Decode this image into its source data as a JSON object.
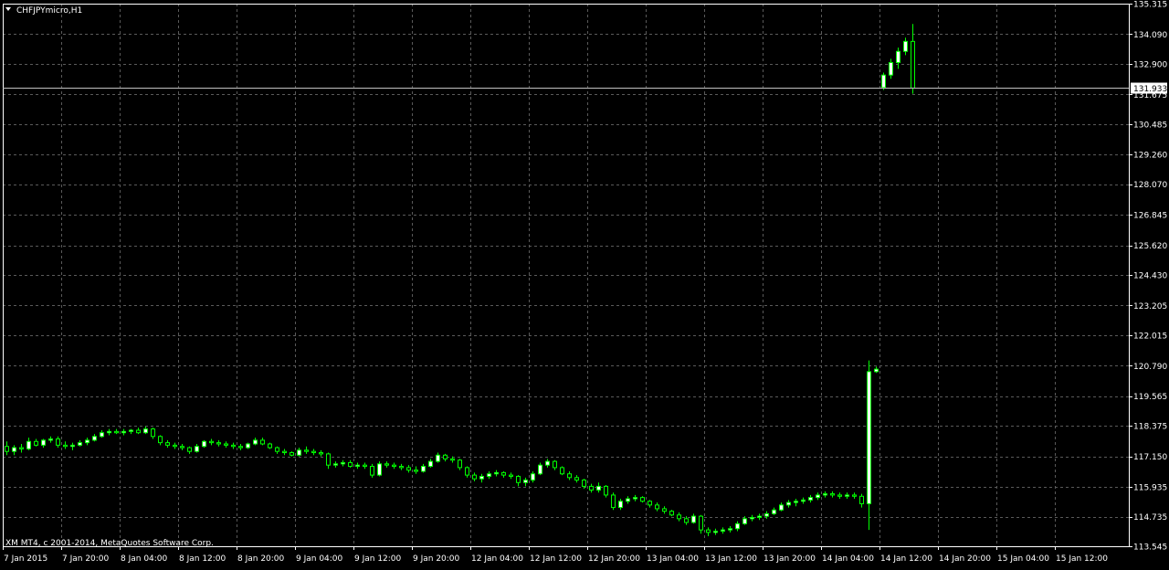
{
  "window": {
    "symbol_label": "CHFJPYmicro,H1",
    "copyright": "XM MT4, c 2001-2014, MetaQuotes Software Corp."
  },
  "colors": {
    "background": "#000000",
    "foreground": "#FFFFFF",
    "grid": "#5A5A5A",
    "bull_candle_fill": "#FFFFFF",
    "bear_candle_fill": "#000000",
    "candle_outline": "#00FF00",
    "bid_line": "#C0C0C0",
    "bid_label_bg": "#FFFFFF",
    "bid_label_text": "#000000"
  },
  "chart_data": {
    "type": "candlestick",
    "timeframe": "H1",
    "y_range": [
      113.545,
      135.315
    ],
    "y_ticks": [
      "135.315",
      "134.090",
      "132.900",
      "131.675",
      "130.485",
      "129.260",
      "128.070",
      "126.845",
      "125.620",
      "124.430",
      "123.205",
      "122.015",
      "120.790",
      "119.565",
      "118.375",
      "117.150",
      "115.935",
      "114.735",
      "113.545"
    ],
    "x_ticks": [
      "7 Jan 2015",
      "7 Jan 20:00",
      "8 Jan 04:00",
      "8 Jan 12:00",
      "8 Jan 20:00",
      "9 Jan 04:00",
      "9 Jan 12:00",
      "9 Jan 20:00",
      "12 Jan 04:00",
      "12 Jan 12:00",
      "12 Jan 20:00",
      "13 Jan 04:00",
      "13 Jan 12:00",
      "13 Jan 20:00",
      "14 Jan 04:00",
      "14 Jan 12:00",
      "14 Jan 20:00",
      "15 Jan 04:00",
      "15 Jan 12:00"
    ],
    "bid_price": "131.933",
    "bid_value": 131.933,
    "grid": true,
    "candles": [
      {
        "o": 117.55,
        "h": 117.75,
        "l": 117.2,
        "c": 117.35
      },
      {
        "o": 117.35,
        "h": 117.6,
        "l": 117.2,
        "c": 117.5
      },
      {
        "o": 117.5,
        "h": 117.65,
        "l": 117.3,
        "c": 117.45
      },
      {
        "o": 117.45,
        "h": 117.9,
        "l": 117.4,
        "c": 117.75
      },
      {
        "o": 117.75,
        "h": 117.85,
        "l": 117.55,
        "c": 117.6
      },
      {
        "o": 117.6,
        "h": 117.85,
        "l": 117.5,
        "c": 117.8
      },
      {
        "o": 117.8,
        "h": 117.95,
        "l": 117.7,
        "c": 117.85
      },
      {
        "o": 117.85,
        "h": 117.95,
        "l": 117.5,
        "c": 117.6
      },
      {
        "o": 117.6,
        "h": 117.75,
        "l": 117.45,
        "c": 117.55
      },
      {
        "o": 117.55,
        "h": 117.7,
        "l": 117.4,
        "c": 117.6
      },
      {
        "o": 117.6,
        "h": 117.8,
        "l": 117.55,
        "c": 117.7
      },
      {
        "o": 117.7,
        "h": 117.9,
        "l": 117.6,
        "c": 117.8
      },
      {
        "o": 117.8,
        "h": 118.05,
        "l": 117.75,
        "c": 117.95
      },
      {
        "o": 117.95,
        "h": 118.2,
        "l": 117.9,
        "c": 118.1
      },
      {
        "o": 118.1,
        "h": 118.25,
        "l": 118.0,
        "c": 118.15
      },
      {
        "o": 118.15,
        "h": 118.25,
        "l": 118.05,
        "c": 118.1
      },
      {
        "o": 118.1,
        "h": 118.25,
        "l": 118.0,
        "c": 118.15
      },
      {
        "o": 118.15,
        "h": 118.25,
        "l": 118.05,
        "c": 118.2
      },
      {
        "o": 118.2,
        "h": 118.3,
        "l": 118.05,
        "c": 118.1
      },
      {
        "o": 118.1,
        "h": 118.35,
        "l": 118.05,
        "c": 118.25
      },
      {
        "o": 118.25,
        "h": 118.3,
        "l": 117.85,
        "c": 117.95
      },
      {
        "o": 117.95,
        "h": 118.0,
        "l": 117.6,
        "c": 117.7
      },
      {
        "o": 117.7,
        "h": 117.8,
        "l": 117.5,
        "c": 117.6
      },
      {
        "o": 117.6,
        "h": 117.7,
        "l": 117.45,
        "c": 117.55
      },
      {
        "o": 117.55,
        "h": 117.65,
        "l": 117.4,
        "c": 117.5
      },
      {
        "o": 117.5,
        "h": 117.55,
        "l": 117.25,
        "c": 117.35
      },
      {
        "o": 117.35,
        "h": 117.65,
        "l": 117.3,
        "c": 117.55
      },
      {
        "o": 117.55,
        "h": 117.8,
        "l": 117.5,
        "c": 117.75
      },
      {
        "o": 117.75,
        "h": 117.85,
        "l": 117.6,
        "c": 117.7
      },
      {
        "o": 117.7,
        "h": 117.8,
        "l": 117.55,
        "c": 117.65
      },
      {
        "o": 117.65,
        "h": 117.75,
        "l": 117.5,
        "c": 117.6
      },
      {
        "o": 117.6,
        "h": 117.7,
        "l": 117.45,
        "c": 117.55
      },
      {
        "o": 117.55,
        "h": 117.65,
        "l": 117.4,
        "c": 117.5
      },
      {
        "o": 117.5,
        "h": 117.7,
        "l": 117.45,
        "c": 117.65
      },
      {
        "o": 117.65,
        "h": 117.9,
        "l": 117.6,
        "c": 117.8
      },
      {
        "o": 117.8,
        "h": 117.9,
        "l": 117.6,
        "c": 117.65
      },
      {
        "o": 117.65,
        "h": 117.7,
        "l": 117.45,
        "c": 117.5
      },
      {
        "o": 117.5,
        "h": 117.55,
        "l": 117.25,
        "c": 117.35
      },
      {
        "o": 117.35,
        "h": 117.45,
        "l": 117.2,
        "c": 117.3
      },
      {
        "o": 117.3,
        "h": 117.35,
        "l": 117.15,
        "c": 117.2
      },
      {
        "o": 117.2,
        "h": 117.5,
        "l": 117.15,
        "c": 117.4
      },
      {
        "o": 117.4,
        "h": 117.55,
        "l": 117.25,
        "c": 117.35
      },
      {
        "o": 117.35,
        "h": 117.45,
        "l": 117.2,
        "c": 117.3
      },
      {
        "o": 117.3,
        "h": 117.4,
        "l": 117.15,
        "c": 117.25
      },
      {
        "o": 117.25,
        "h": 117.3,
        "l": 116.65,
        "c": 116.8
      },
      {
        "o": 116.8,
        "h": 116.95,
        "l": 116.7,
        "c": 116.85
      },
      {
        "o": 116.85,
        "h": 117.0,
        "l": 116.75,
        "c": 116.9
      },
      {
        "o": 116.9,
        "h": 117.0,
        "l": 116.7,
        "c": 116.75
      },
      {
        "o": 116.75,
        "h": 116.9,
        "l": 116.65,
        "c": 116.8
      },
      {
        "o": 116.8,
        "h": 116.9,
        "l": 116.65,
        "c": 116.75
      },
      {
        "o": 116.75,
        "h": 116.85,
        "l": 116.3,
        "c": 116.4
      },
      {
        "o": 116.4,
        "h": 116.95,
        "l": 116.35,
        "c": 116.85
      },
      {
        "o": 116.85,
        "h": 116.95,
        "l": 116.7,
        "c": 116.8
      },
      {
        "o": 116.8,
        "h": 116.9,
        "l": 116.65,
        "c": 116.75
      },
      {
        "o": 116.75,
        "h": 116.85,
        "l": 116.6,
        "c": 116.7
      },
      {
        "o": 116.7,
        "h": 116.8,
        "l": 116.5,
        "c": 116.6
      },
      {
        "o": 116.6,
        "h": 116.75,
        "l": 116.45,
        "c": 116.55
      },
      {
        "o": 116.55,
        "h": 116.85,
        "l": 116.5,
        "c": 116.75
      },
      {
        "o": 116.75,
        "h": 117.05,
        "l": 116.7,
        "c": 116.95
      },
      {
        "o": 116.95,
        "h": 117.3,
        "l": 116.9,
        "c": 117.2
      },
      {
        "o": 117.2,
        "h": 117.25,
        "l": 116.95,
        "c": 117.05
      },
      {
        "o": 117.05,
        "h": 117.15,
        "l": 116.9,
        "c": 117.0
      },
      {
        "o": 117.0,
        "h": 117.05,
        "l": 116.6,
        "c": 116.7
      },
      {
        "o": 116.7,
        "h": 116.75,
        "l": 116.3,
        "c": 116.4
      },
      {
        "o": 116.4,
        "h": 116.5,
        "l": 116.15,
        "c": 116.25
      },
      {
        "o": 116.25,
        "h": 116.45,
        "l": 116.1,
        "c": 116.35
      },
      {
        "o": 116.35,
        "h": 116.55,
        "l": 116.25,
        "c": 116.45
      },
      {
        "o": 116.45,
        "h": 116.6,
        "l": 116.35,
        "c": 116.5
      },
      {
        "o": 116.5,
        "h": 116.55,
        "l": 116.3,
        "c": 116.4
      },
      {
        "o": 116.4,
        "h": 116.5,
        "l": 116.25,
        "c": 116.35
      },
      {
        "o": 116.35,
        "h": 116.4,
        "l": 115.95,
        "c": 116.1
      },
      {
        "o": 116.1,
        "h": 116.3,
        "l": 115.95,
        "c": 116.2
      },
      {
        "o": 116.2,
        "h": 116.55,
        "l": 116.1,
        "c": 116.45
      },
      {
        "o": 116.45,
        "h": 116.9,
        "l": 116.4,
        "c": 116.8
      },
      {
        "o": 116.8,
        "h": 117.05,
        "l": 116.7,
        "c": 116.95
      },
      {
        "o": 116.95,
        "h": 117.0,
        "l": 116.6,
        "c": 116.7
      },
      {
        "o": 116.7,
        "h": 116.75,
        "l": 116.4,
        "c": 116.45
      },
      {
        "o": 116.45,
        "h": 116.55,
        "l": 116.2,
        "c": 116.3
      },
      {
        "o": 116.3,
        "h": 116.4,
        "l": 116.1,
        "c": 116.2
      },
      {
        "o": 116.2,
        "h": 116.25,
        "l": 115.85,
        "c": 115.95
      },
      {
        "o": 115.95,
        "h": 116.05,
        "l": 115.7,
        "c": 115.8
      },
      {
        "o": 115.8,
        "h": 116.1,
        "l": 115.7,
        "c": 115.95
      },
      {
        "o": 115.95,
        "h": 116.0,
        "l": 115.5,
        "c": 115.6
      },
      {
        "o": 115.6,
        "h": 115.7,
        "l": 115.0,
        "c": 115.1
      },
      {
        "o": 115.1,
        "h": 115.45,
        "l": 115.0,
        "c": 115.35
      },
      {
        "o": 115.35,
        "h": 115.55,
        "l": 115.25,
        "c": 115.45
      },
      {
        "o": 115.45,
        "h": 115.6,
        "l": 115.35,
        "c": 115.5
      },
      {
        "o": 115.5,
        "h": 115.55,
        "l": 115.3,
        "c": 115.35
      },
      {
        "o": 115.35,
        "h": 115.4,
        "l": 115.1,
        "c": 115.2
      },
      {
        "o": 115.2,
        "h": 115.3,
        "l": 114.95,
        "c": 115.05
      },
      {
        "o": 115.05,
        "h": 115.15,
        "l": 114.85,
        "c": 114.95
      },
      {
        "o": 114.95,
        "h": 115.0,
        "l": 114.75,
        "c": 114.8
      },
      {
        "o": 114.8,
        "h": 114.9,
        "l": 114.55,
        "c": 114.65
      },
      {
        "o": 114.65,
        "h": 114.75,
        "l": 114.4,
        "c": 114.5
      },
      {
        "o": 114.5,
        "h": 114.85,
        "l": 114.45,
        "c": 114.75
      },
      {
        "o": 114.75,
        "h": 114.8,
        "l": 114.05,
        "c": 114.2
      },
      {
        "o": 114.2,
        "h": 114.3,
        "l": 113.95,
        "c": 114.1
      },
      {
        "o": 114.1,
        "h": 114.25,
        "l": 114.0,
        "c": 114.15
      },
      {
        "o": 114.15,
        "h": 114.3,
        "l": 114.05,
        "c": 114.2
      },
      {
        "o": 114.2,
        "h": 114.35,
        "l": 114.1,
        "c": 114.25
      },
      {
        "o": 114.25,
        "h": 114.55,
        "l": 114.15,
        "c": 114.45
      },
      {
        "o": 114.45,
        "h": 114.75,
        "l": 114.4,
        "c": 114.65
      },
      {
        "o": 114.65,
        "h": 114.8,
        "l": 114.55,
        "c": 114.7
      },
      {
        "o": 114.7,
        "h": 114.85,
        "l": 114.6,
        "c": 114.75
      },
      {
        "o": 114.75,
        "h": 114.95,
        "l": 114.65,
        "c": 114.85
      },
      {
        "o": 114.85,
        "h": 115.1,
        "l": 114.8,
        "c": 115.0
      },
      {
        "o": 115.0,
        "h": 115.3,
        "l": 114.95,
        "c": 115.2
      },
      {
        "o": 115.2,
        "h": 115.4,
        "l": 115.1,
        "c": 115.3
      },
      {
        "o": 115.3,
        "h": 115.45,
        "l": 115.15,
        "c": 115.35
      },
      {
        "o": 115.35,
        "h": 115.5,
        "l": 115.25,
        "c": 115.4
      },
      {
        "o": 115.4,
        "h": 115.6,
        "l": 115.3,
        "c": 115.5
      },
      {
        "o": 115.5,
        "h": 115.7,
        "l": 115.4,
        "c": 115.6
      },
      {
        "o": 115.6,
        "h": 115.75,
        "l": 115.5,
        "c": 115.65
      },
      {
        "o": 115.65,
        "h": 115.75,
        "l": 115.5,
        "c": 115.6
      },
      {
        "o": 115.6,
        "h": 115.7,
        "l": 115.45,
        "c": 115.55
      },
      {
        "o": 115.55,
        "h": 115.7,
        "l": 115.45,
        "c": 115.6
      },
      {
        "o": 115.6,
        "h": 115.7,
        "l": 115.45,
        "c": 115.55
      },
      {
        "o": 115.55,
        "h": 115.65,
        "l": 115.1,
        "c": 115.25
      },
      {
        "o": 115.25,
        "h": 121.0,
        "l": 114.2,
        "c": 120.55
      },
      {
        "o": 120.55,
        "h": 120.75,
        "l": 120.5,
        "c": 120.65
      },
      {
        "o": 131.95,
        "h": 132.55,
        "l": 131.85,
        "c": 132.45
      },
      {
        "o": 132.45,
        "h": 133.1,
        "l": 132.3,
        "c": 132.95
      },
      {
        "o": 132.95,
        "h": 133.55,
        "l": 132.7,
        "c": 133.4
      },
      {
        "o": 133.4,
        "h": 133.95,
        "l": 133.25,
        "c": 133.8
      },
      {
        "o": 133.8,
        "h": 134.5,
        "l": 131.7,
        "c": 131.93
      }
    ]
  }
}
